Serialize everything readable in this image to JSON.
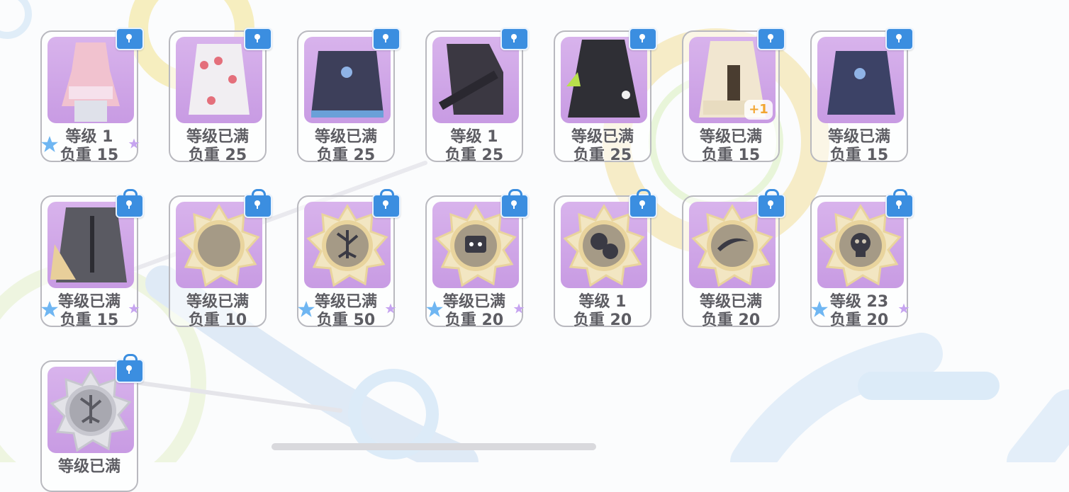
{
  "colors": {
    "art_bg": "#d3a9ea",
    "lock_blue": "#3b8ee0",
    "text": "#5d5d63",
    "plus": "#f2a531"
  },
  "cards": [
    {
      "level": "等级 1",
      "weight": "负重 15",
      "art": "dress-pink-icon",
      "plus": "",
      "small_lock": true,
      "stars": true
    },
    {
      "level": "等级已满",
      "weight": "负重 25",
      "art": "dress-white-roses-icon",
      "plus": "",
      "small_lock": true,
      "stars": false
    },
    {
      "level": "等级已满",
      "weight": "负重 25",
      "art": "dress-dark-blue-icon",
      "plus": "",
      "small_lock": true,
      "stars": false
    },
    {
      "level": "等级 1",
      "weight": "负重 25",
      "art": "gun-dark-icon",
      "plus": "",
      "small_lock": true,
      "stars": false
    },
    {
      "level": "等级已满",
      "weight": "负重 25",
      "art": "cloak-black-icon",
      "plus": "",
      "small_lock": true,
      "stars": false
    },
    {
      "level": "等级已满",
      "weight": "负重 15",
      "art": "dress-gold-icon",
      "plus": "+1",
      "small_lock": true,
      "stars": false
    },
    {
      "level": "等级已满",
      "weight": "负重 15",
      "art": "dress-navy-icon",
      "plus": "",
      "small_lock": true,
      "stars": false
    },
    {
      "level": "等级已满",
      "weight": "负重 15",
      "art": "coat-gray-icon",
      "plus": "",
      "small_lock": false,
      "stars": true
    },
    {
      "level": "等级已满",
      "weight": "负重 10",
      "art": "medal-moon-icon",
      "plus": "",
      "small_lock": false,
      "stars": false
    },
    {
      "level": "等级已满",
      "weight": "负重 50",
      "art": "medal-tree-icon",
      "plus": "",
      "small_lock": false,
      "stars": true
    },
    {
      "level": "等级已满",
      "weight": "负重 20",
      "art": "medal-robot-icon",
      "plus": "",
      "small_lock": false,
      "stars": true
    },
    {
      "level": "等级 1",
      "weight": "负重 20",
      "art": "medal-masks-icon",
      "plus": "",
      "small_lock": false,
      "stars": false
    },
    {
      "level": "等级已满",
      "weight": "负重 20",
      "art": "medal-boomerang-icon",
      "plus": "",
      "small_lock": false,
      "stars": false
    },
    {
      "level": "等级 23",
      "weight": "负重 20",
      "art": "medal-skull-icon",
      "plus": "",
      "small_lock": false,
      "stars": true
    },
    {
      "level": "等级已满",
      "weight": "",
      "art": "medal-silver-tree-icon",
      "plus": "",
      "small_lock": false,
      "stars": false
    }
  ]
}
